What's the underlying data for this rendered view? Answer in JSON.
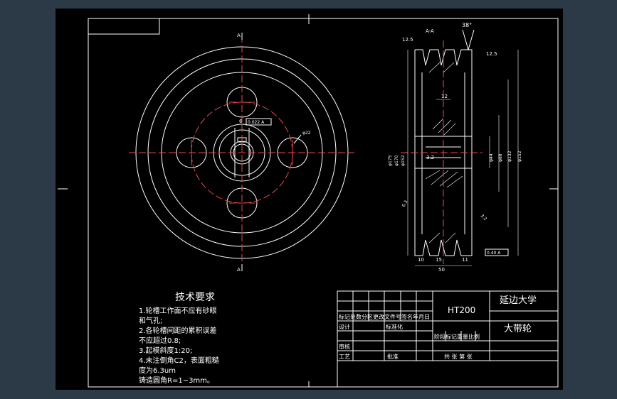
{
  "drawing": {
    "section_label": "A-A",
    "cut_marks": [
      "A",
      "A"
    ],
    "angle": "38°",
    "roughness": [
      "12.5",
      "12.5"
    ],
    "dims": {
      "hub_width": "12",
      "d1": "φ175",
      "d2": "φ170",
      "d3": "φ152",
      "d4": "φ44",
      "d5": "φ88",
      "d6": "φ132",
      "d7": "φ152",
      "bottom_total": "50",
      "bottom_left": "10",
      "bottom_mid": "15",
      "bottom_right": "11",
      "key": "6",
      "tol": "0.022 A",
      "hole": "φ22",
      "bore_chamfer": "3.2",
      "small_left": "6.3",
      "small_right": "3.2",
      "bottom_tol": "0.40 A"
    }
  },
  "tech": {
    "title": "技术要求",
    "lines": [
      "1.轮槽工作面不应有砂眼",
      "和气孔;",
      "2.各轮槽间距的累积误差",
      "不应超过0.8;",
      "3.起模斜度1:20;",
      "4.未注倒角C2，表面粗糙",
      "度为6.3um",
      "铸造圆角R=1~3mm。"
    ]
  },
  "title_block": {
    "material": "HT200",
    "school": "延边大学",
    "part_name": "大带轮",
    "rev_header": "标记处数分区更改文件号签名年月日",
    "design": "设计",
    "standardize": "标准化",
    "stage_header": "阶段标记重量比例",
    "review": "审核",
    "process": "工艺",
    "approve": "批准",
    "sheets": "共    张  第    张"
  }
}
